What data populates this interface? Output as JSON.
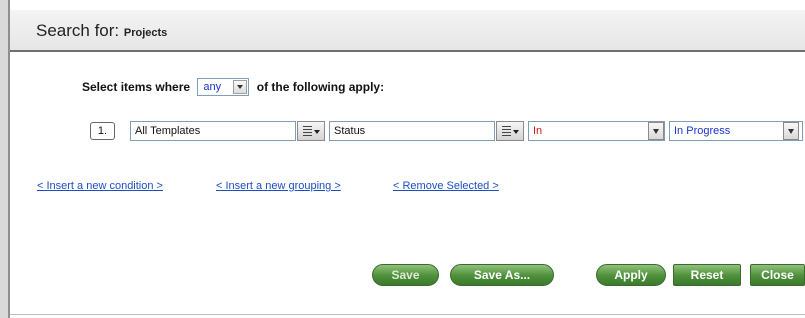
{
  "header": {
    "title": "Search for:",
    "subtitle": "Projects"
  },
  "criteria": {
    "prefix": "Select items where",
    "match_value": "any",
    "suffix": "of the following apply:"
  },
  "condition": {
    "number": "1.",
    "template": "All Templates",
    "attribute": "Status",
    "operator": "In",
    "value": "In Progress"
  },
  "links": {
    "insert_condition": "< Insert a new condition >",
    "insert_grouping": "< Insert a new grouping >",
    "remove_selected": "< Remove Selected >"
  },
  "buttons": {
    "save": "Save",
    "save_as": "Save As...",
    "apply": "Apply",
    "reset": "Reset",
    "close": "Close"
  },
  "colors": {
    "button_green": "#4d8f3a",
    "link_blue": "#1c4fc4",
    "operator_red": "#c41b1b",
    "value_blue": "#1a33cc"
  }
}
